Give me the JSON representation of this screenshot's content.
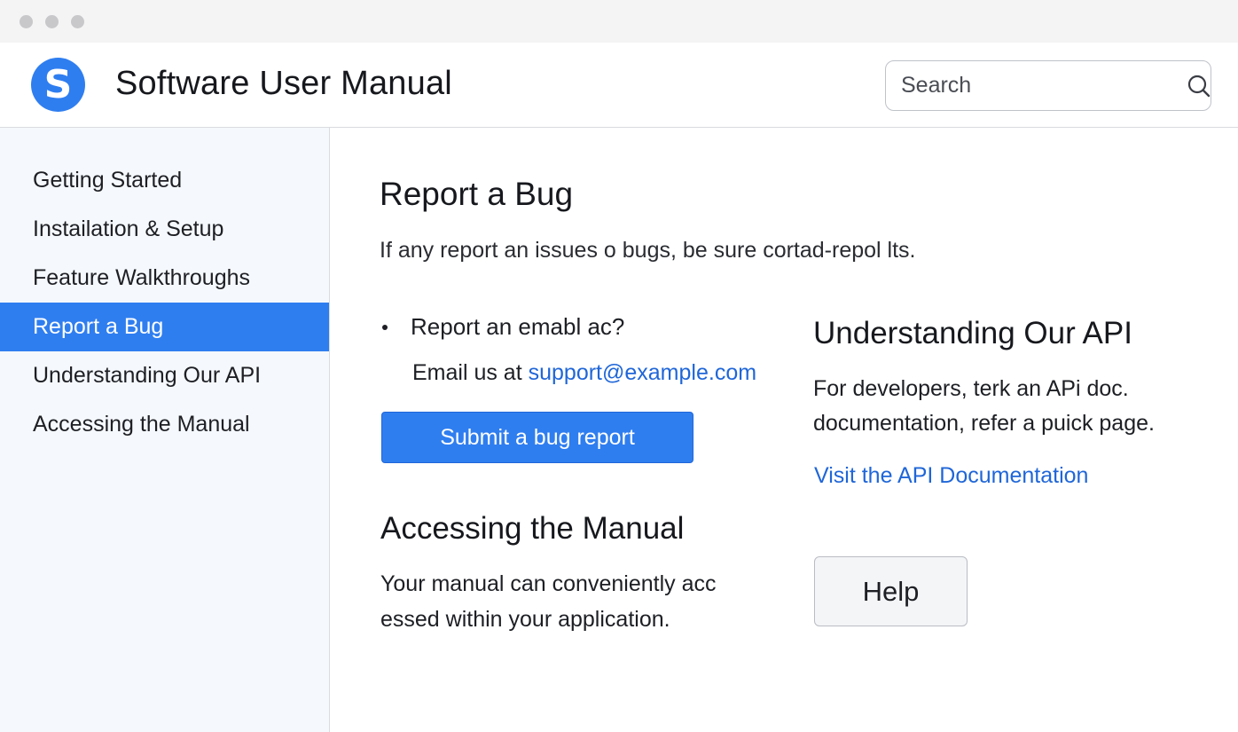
{
  "window": {
    "controls": [
      "traffic-dot",
      "traffic-dot",
      "traffic-dot"
    ]
  },
  "header": {
    "logo_letter": "S",
    "title": "Software User Manual",
    "search": {
      "placeholder": "Search",
      "value": "",
      "icon": "search-icon"
    }
  },
  "sidebar": {
    "items": [
      {
        "label": "Getting Started",
        "active": false
      },
      {
        "label": "Instailation & Setup",
        "active": false
      },
      {
        "label": "Feature Walkthroughs",
        "active": false
      },
      {
        "label": "Report a Bug",
        "active": true
      },
      {
        "label": "Understanding Our API",
        "active": false
      },
      {
        "label": "Accessing the Manual",
        "active": false
      }
    ]
  },
  "main": {
    "report": {
      "heading": "Report a Bug",
      "intro": "If any report an issues o bugs, be sure cortad-repol lts.",
      "bullet": "Report an emabl ac?",
      "email_prefix": "Email us at ",
      "email_link": "support@example.com",
      "submit_label": "Submit a bug report"
    },
    "access": {
      "heading": "Accessing the Manual",
      "text": "Your manual can conveniently acc essed within your application."
    },
    "api": {
      "heading": "Understanding Our API",
      "text": "For developers, terk an APi doc. documentation, refer a puick page.",
      "link": "Visit the API Documentation"
    },
    "help_label": "Help"
  },
  "colors": {
    "accent": "#2f7ef0",
    "link": "#1f66d8",
    "sidebar_bg": "#f5f8fc",
    "titlebar_bg": "#f4f4f5"
  }
}
